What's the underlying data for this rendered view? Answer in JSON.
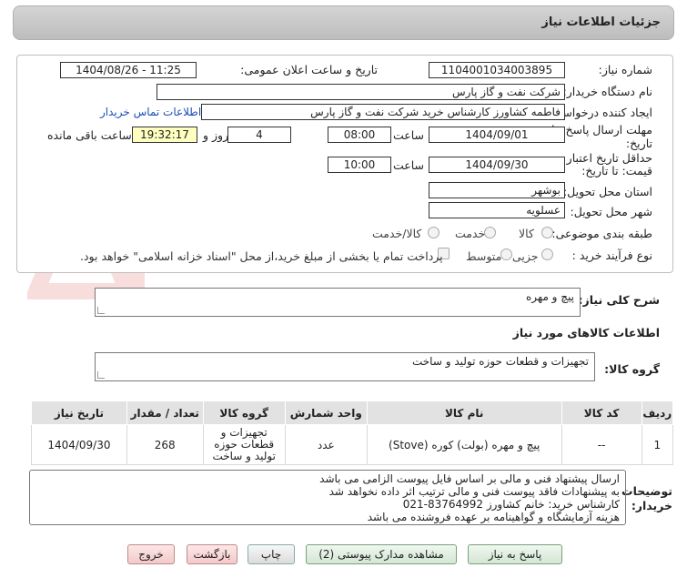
{
  "header": {
    "title": "جزئیات اطلاعات نیاز"
  },
  "fields": {
    "need_number_label": "شماره نیاز:",
    "need_number": "1104001034003895",
    "announce_label": "تاریخ و ساعت اعلان عمومی:",
    "announce_value": "1404/08/26 - 11:25",
    "buyer_org_label": "نام دستگاه خریدار:",
    "buyer_org": "شرکت نفت و گاز پارس",
    "creator_label": "ایجاد کننده درخواست:",
    "creator": "فاطمه کشاورز کارشناس خرید  شرکت نفت و گاز پارس",
    "contact_link": "اطلاعات تماس خریدار",
    "deadline_label_1": "مهلت ارسال پاسخ: تا",
    "deadline_label_2": "تاریخ:",
    "deadline_date": "1404/09/01",
    "time_label": "ساعت",
    "deadline_time": "08:00",
    "days_value": "4",
    "days_label": "روز و",
    "remaining_time": "19:32:17",
    "remaining_label": "ساعت باقی مانده",
    "validity_label_1": "حداقل تاریخ اعتبار",
    "validity_label_2": "قیمت: تا تاریخ:",
    "validity_date": "1404/09/30",
    "validity_time": "10:00",
    "province_label": "استان محل تحویل:",
    "province": "بوشهر",
    "city_label": "شهر محل تحویل:",
    "city": "عسلویه",
    "category_label": "طبقه بندی موضوعی:",
    "category_options": [
      "کالا",
      "خدمت",
      "کالا/خدمت"
    ],
    "process_label": "نوع فرآیند خرید :",
    "process_options": [
      "جزیی",
      "متوسط"
    ],
    "payment_note": "پرداخت تمام یا بخشی از مبلغ خرید،از محل \"اسناد خزانه اسلامی\" خواهد بود."
  },
  "description": {
    "label": "شرح کلی نیاز:",
    "value": "پیچ و مهره"
  },
  "goods_info": {
    "label": "اطلاعات کالاهای مورد نیاز",
    "group_label": "گروه کالا:",
    "group_value": "تجهیزات و قطعات حوزه تولید و ساخت"
  },
  "table": {
    "headers": [
      "ردیف",
      "کد کالا",
      "نام کالا",
      "واحد شمارش",
      "گروه کالا",
      "تعداد / مقدار",
      "تاریخ نیاز"
    ],
    "rows": [
      {
        "row": "1",
        "code": "--",
        "name": "پیچ و مهره (بولت) کوره (Stove)",
        "unit": "عدد",
        "group": "تجهیزات و قطعات حوزه تولید و ساخت",
        "qty": "268",
        "date": "1404/09/30"
      }
    ]
  },
  "notes": {
    "label_1": "توضیحات",
    "label_2": "خریدار:",
    "lines": [
      "ارسال پیشنهاد فنی و مالی بر اساس فایل پیوست الزامی می باشد",
      "به پیشنهادات فاقد پیوست فنی و مالی ترتیب اثر داده نخواهد شد",
      "کارشناس خرید: خانم کشاورز  83764992-021",
      "هزینه آزمایشگاه و گواهینامه بر عهده فروشنده می باشد"
    ]
  },
  "buttons": {
    "reply": "پاسخ به نیاز",
    "attachments": "مشاهده مدارک پیوستی (2)",
    "print": "چاپ",
    "back": "بازگشت",
    "exit": "خروج"
  },
  "watermark": {
    "text": "AriaTender.neT"
  },
  "colors": {
    "link": "#1a4fb5",
    "highlight": "#ffffc0",
    "header_bg": "#c8c8c8"
  }
}
